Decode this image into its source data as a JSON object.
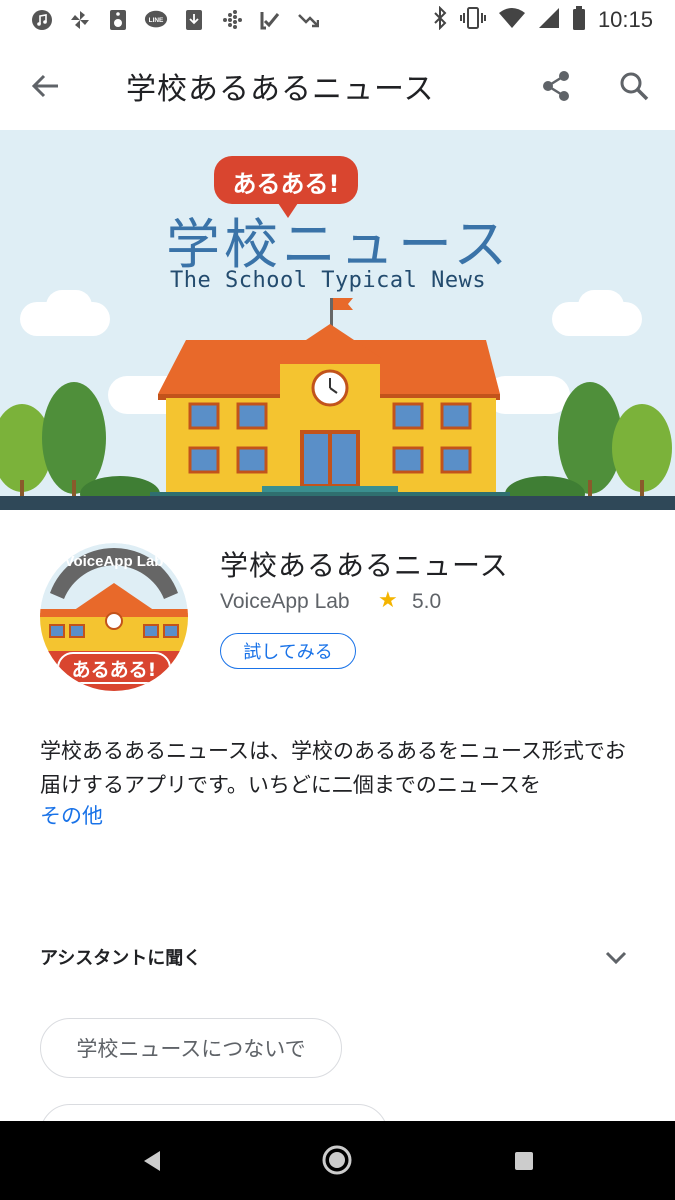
{
  "status_bar": {
    "time": "10:15",
    "icons": [
      "music-icon",
      "pinwheel-icon",
      "speaker-icon",
      "line-icon",
      "download-icon",
      "fitbit-icon",
      "check-icon",
      "trend-icon",
      "bluetooth-icon",
      "vibrate-icon",
      "wifi-icon",
      "signal-icon",
      "battery-icon"
    ]
  },
  "app_bar": {
    "title": "学校あるあるニュース"
  },
  "banner": {
    "bubble_text": "あるある!",
    "title": "学校ニュース",
    "subtitle": "The School Typical News"
  },
  "app": {
    "name": "学校あるあるニュース",
    "developer": "VoiceApp Lab",
    "rating": "5.0",
    "try_label": "試してみる",
    "icon_top_text": "VoiceApp Lab",
    "icon_bottom_text": "あるある!"
  },
  "description": {
    "text": "学校あるあるニュースは、学校のあるあるをニュース形式でお届けするアプリです。いちどに二個までのニュースを",
    "more_label": "その他"
  },
  "ask_section": {
    "title": "アシスタントに聞く",
    "chips": [
      "学校ニュースにつないで"
    ]
  },
  "colors": {
    "accent": "#1a73e8",
    "banner_sky": "#dfeef5",
    "school_yellow": "#f4c430",
    "roof_orange": "#e8692a"
  }
}
